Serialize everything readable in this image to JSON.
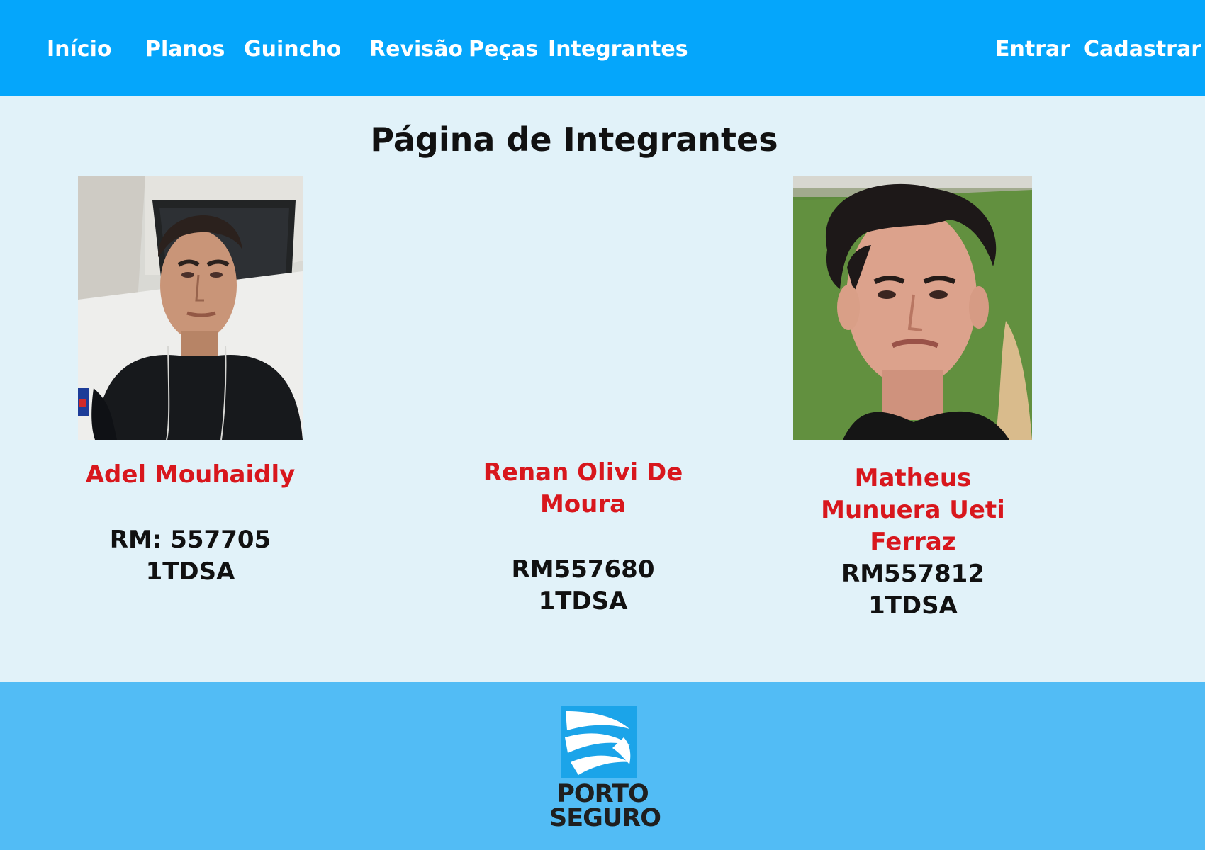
{
  "nav": {
    "left": [
      "Início",
      "Planos",
      "Guincho",
      "Revisão",
      "Peças",
      "Integrantes"
    ],
    "right": [
      "Entrar",
      "Cadastrar"
    ]
  },
  "page": {
    "title": "Página de Integrantes"
  },
  "members": [
    {
      "name": "Adel Mouhaidly",
      "rm": "RM: 557705",
      "class": "1TDSA",
      "photo": "photo-adel-mouhaidly"
    },
    {
      "name": "Renan Olivi De Moura",
      "rm": "RM557680",
      "class": "1TDSA",
      "photo": "none"
    },
    {
      "name": "Matheus Munuera Ueti Ferraz",
      "rm": "RM557812",
      "class": "1TDSA",
      "photo": "photo-matheus-munuera-ueti-ferraz"
    }
  ],
  "footer": {
    "logo": {
      "brand_line_1": "PORTO",
      "brand_line_2": "SEGURO",
      "icon": "porto-seguro-logo"
    }
  },
  "colors": {
    "navbar": "#05a6fb",
    "main_background": "#e1f2f9",
    "footer": "#52bcf5",
    "member_name": "#d8171d",
    "text": "#111111"
  }
}
